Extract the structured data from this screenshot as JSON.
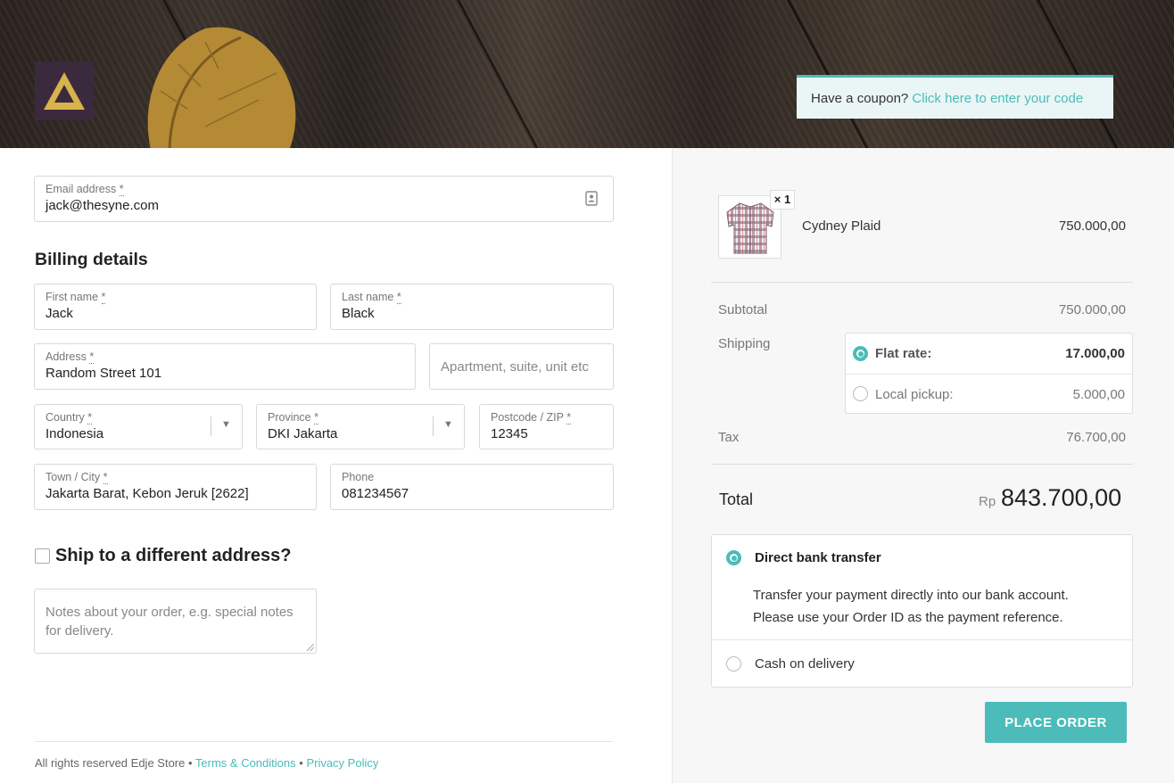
{
  "header": {
    "coupon_prefix": "Have a coupon?",
    "coupon_link": "Click here to enter your code"
  },
  "form": {
    "email_label": "Email address",
    "email_value": "jack@thesyne.com",
    "billing_title": "Billing details",
    "first_name_label": "First name",
    "first_name_value": "Jack",
    "last_name_label": "Last name",
    "last_name_value": "Black",
    "address_label": "Address",
    "address_value": "Random Street 101",
    "address2_placeholder": "Apartment, suite, unit etc",
    "country_label": "Country",
    "country_value": "Indonesia",
    "province_label": "Province",
    "province_value": "DKI Jakarta",
    "postcode_label": "Postcode / ZIP",
    "postcode_value": "12345",
    "town_label": "Town / City",
    "town_value": "Jakarta Barat, Kebon Jeruk [2622]",
    "phone_label": "Phone",
    "phone_value": "081234567",
    "ship_different": "Ship to a different address?",
    "notes_placeholder": "Notes about your order, e.g. special notes for delivery.",
    "required_mark": "*"
  },
  "footer": {
    "text": "All rights reserved Edje Store •",
    "terms": "Terms & Conditions",
    "sep": "•",
    "privacy": "Privacy Policy"
  },
  "order": {
    "product_name": "Cydney Plaid",
    "product_qty": "× 1",
    "product_price": "750.000,00",
    "subtotal_label": "Subtotal",
    "subtotal_value": "750.000,00",
    "shipping_label": "Shipping",
    "shipping_options": [
      {
        "label": "Flat rate:",
        "value": "17.000,00",
        "selected": true
      },
      {
        "label": "Local pickup:",
        "value": "5.000,00",
        "selected": false
      }
    ],
    "tax_label": "Tax",
    "tax_value": "76.700,00",
    "total_label": "Total",
    "total_currency": "Rp",
    "total_value": "843.700,00"
  },
  "payment": {
    "bank_label": "Direct bank transfer",
    "bank_desc_1": "Transfer your payment directly into our bank account.",
    "bank_desc_2": "Please use your Order ID as the payment reference.",
    "cod_label": "Cash on delivery",
    "place_order": "PLACE ORDER"
  },
  "colors": {
    "accent": "#4bbcb9",
    "logo_bg": "#3b2a3e",
    "logo_mark": "#d8b24a"
  }
}
